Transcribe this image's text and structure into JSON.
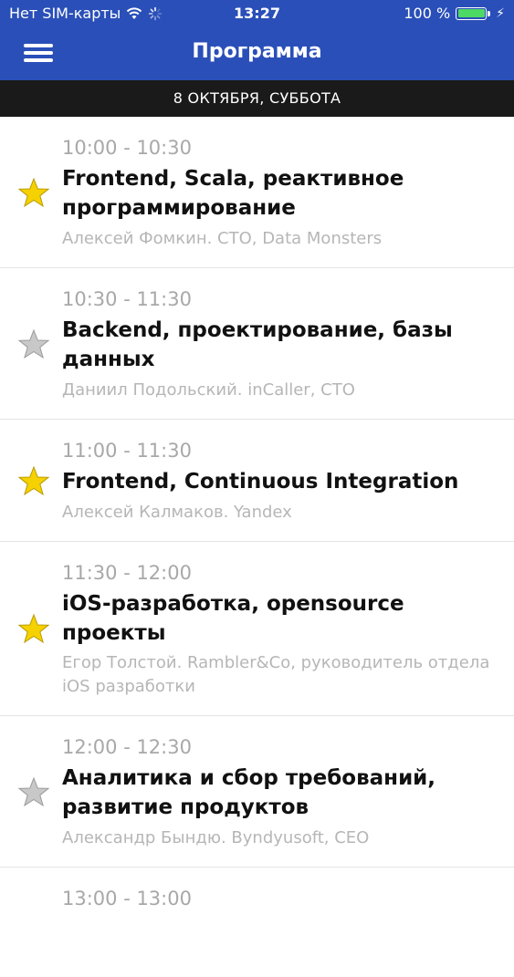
{
  "status_bar": {
    "carrier": "Нет SIM-карты",
    "time": "13:27",
    "battery": "100 %",
    "icons": [
      "wifi-icon",
      "loading-spinner-icon",
      "battery-icon",
      "charging-bolt-icon"
    ]
  },
  "nav": {
    "title": "Программа",
    "menu_icon": "hamburger-menu-icon"
  },
  "date_header": "8 ОКТЯБРЯ, СУББОТА",
  "colors": {
    "nav_bg": "#2A4FB8",
    "date_bg": "#1a1a1a",
    "star_active": "#F5D100",
    "star_inactive": "#C8C8C8"
  },
  "sessions": [
    {
      "time": "10:00 - 10:30",
      "title": "Frontend, Scala, реактивное программирование",
      "speaker": "Алексей Фомкин. CTO, Data Monsters",
      "favorite": true
    },
    {
      "time": "10:30 - 11:30",
      "title": "Backend, проектирование, базы данных",
      "speaker": "Даниил Подольский. inCaller, CTO",
      "favorite": false
    },
    {
      "time": "11:00 - 11:30",
      "title": "Frontend, Continuous Integration",
      "speaker": "Алексей Калмаков. Yandex",
      "favorite": true
    },
    {
      "time": "11:30 - 12:00",
      "title": "iOS-разработка, opensource проекты",
      "speaker": "Егор Толстой. Rambler&Co, руководитель отдела iOS разработки",
      "favorite": true
    },
    {
      "time": "12:00 - 12:30",
      "title": "Аналитика и сбор требований, развитие продуктов",
      "speaker": "Александр Бындю. Byndyusoft, CEO",
      "favorite": false
    },
    {
      "time": "13:00 - 13:00",
      "title": "",
      "speaker": "",
      "favorite": false
    }
  ]
}
